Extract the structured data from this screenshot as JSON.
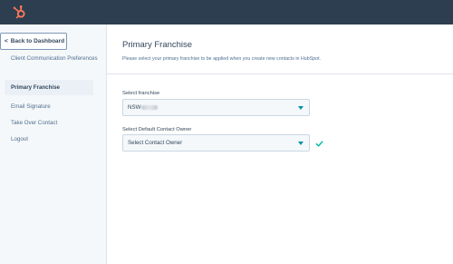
{
  "topbar": {
    "logo_icon": "hubspot-sprocket-icon"
  },
  "sidebar": {
    "back_label": "Back to Dashboard",
    "items": [
      {
        "label": "Client Communication Preferences",
        "active": false
      },
      {
        "label": "Primary Franchise",
        "active": true
      },
      {
        "label": "Email Signature",
        "active": false
      },
      {
        "label": "Take Over Contact",
        "active": false
      },
      {
        "label": "Logout",
        "active": false
      }
    ]
  },
  "main": {
    "title": "Primary Franchise",
    "description": "Please select your primary franchise to be applied when you create new contacts in HubSpot.",
    "franchise": {
      "label": "Select franchise",
      "value": "NSW"
    },
    "owner": {
      "label": "Select Default Contact Owner",
      "value": "Select Contact Owner",
      "status_icon": "checkmark-icon"
    }
  },
  "colors": {
    "topbar": "#2d3e50",
    "accent": "#ff7a59",
    "caret": "#0091ae",
    "check": "#00bda5"
  }
}
